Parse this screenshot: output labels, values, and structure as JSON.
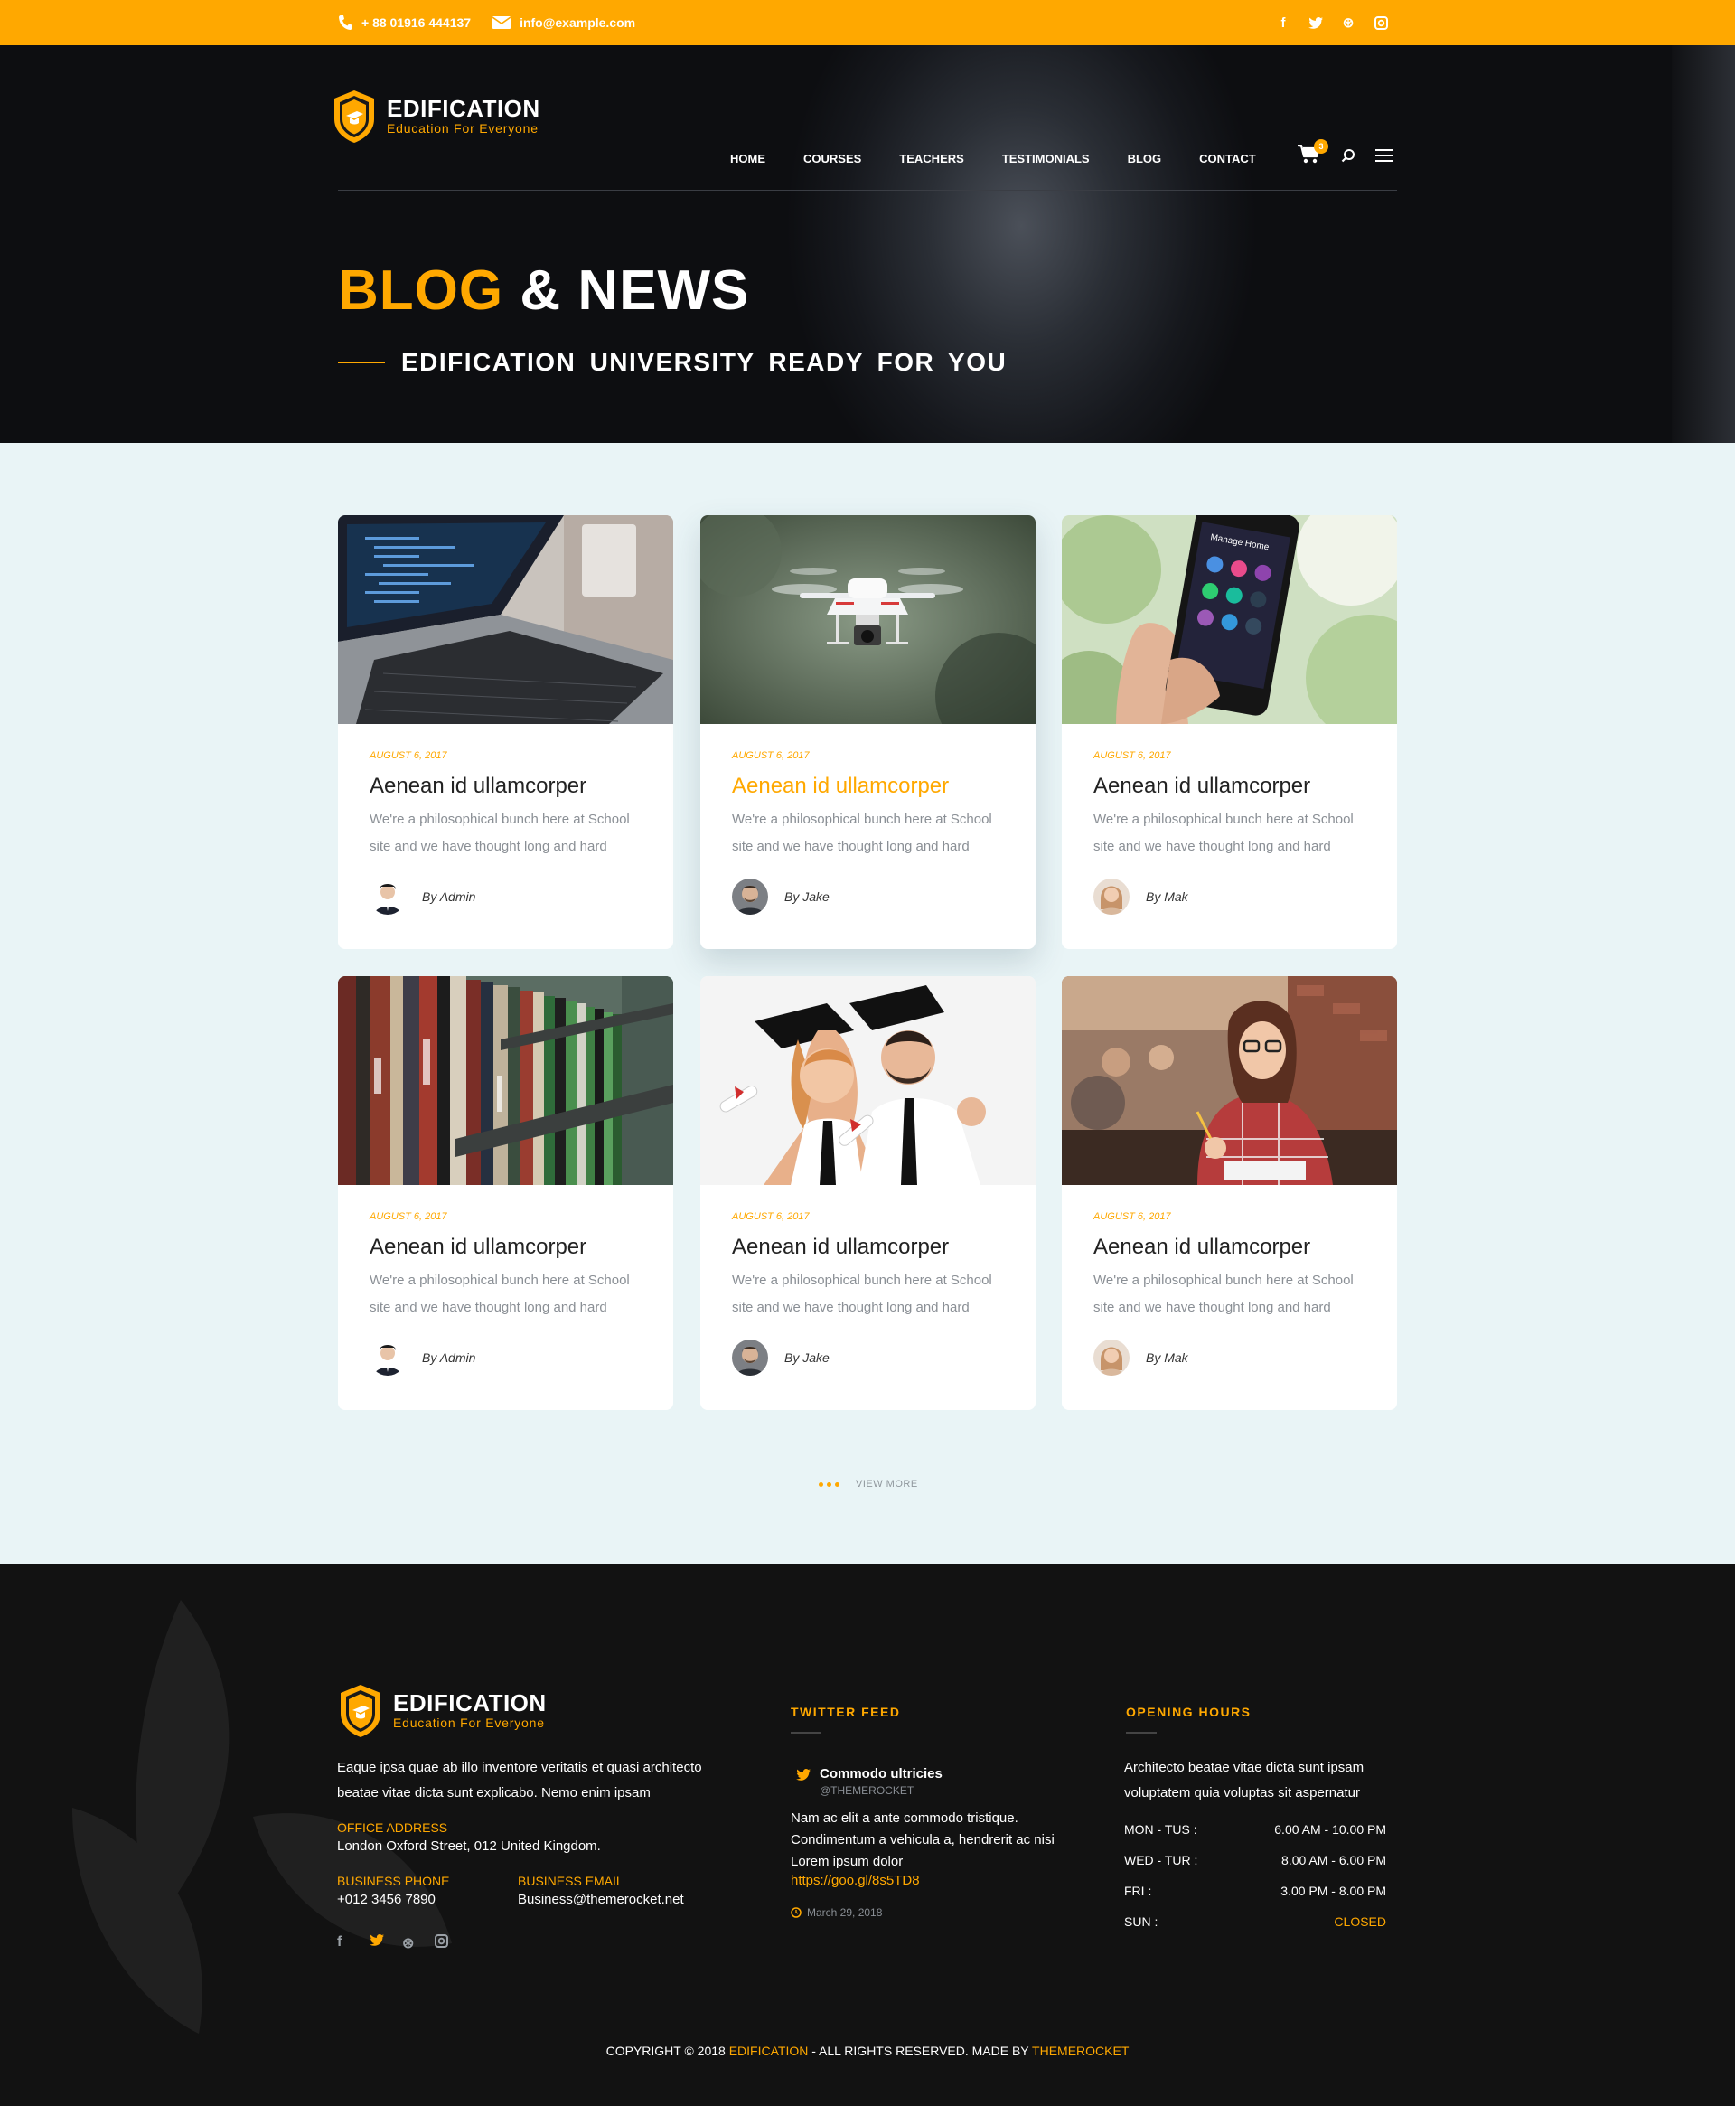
{
  "topbar": {
    "phone": "+ 88 01916 444137",
    "email": "info@example.com",
    "social": [
      {
        "icon": "facebook-icon",
        "glyph": "f"
      },
      {
        "icon": "twitter-icon",
        "glyph": "t"
      },
      {
        "icon": "dribbble-icon",
        "glyph": "⊛"
      },
      {
        "icon": "instagram-icon",
        "glyph": "◙"
      }
    ]
  },
  "brand": {
    "name": "EDIFICATION",
    "tagline": "Education For Everyone"
  },
  "nav": {
    "items": [
      "HOME",
      "COURSES",
      "TEACHERS",
      "TESTIMONIALS",
      "BLOG",
      "CONTACT"
    ],
    "cart_count": "3"
  },
  "hero": {
    "title_accent": "BLOG",
    "title_rest": "& NEWS",
    "subtitle": "EDIFICATION UNIVERSITY READY FOR YOU"
  },
  "posts": [
    {
      "date": "AUGUST 6, 2017",
      "title": "Aenean id ullamcorper",
      "excerpt": "We're a philosophical bunch here at School site and we have thought long and hard",
      "author": "By Admin",
      "image": "laptop-code"
    },
    {
      "date": "AUGUST 6, 2017",
      "title": "Aenean id ullamcorper",
      "excerpt": "We're a philosophical bunch here at School site and we have thought long and hard",
      "author": "By Jake",
      "image": "drone"
    },
    {
      "date": "AUGUST 6, 2017",
      "title": "Aenean id ullamcorper",
      "excerpt": "We're a philosophical bunch here at School site and we have thought long and hard",
      "author": "By Mak",
      "image": "smartphone"
    },
    {
      "date": "AUGUST 6, 2017",
      "title": "Aenean id ullamcorper",
      "excerpt": "We're a philosophical bunch here at School site and we have thought long and hard",
      "author": "By Admin",
      "image": "bookshelf"
    },
    {
      "date": "AUGUST 6, 2017",
      "title": "Aenean id ullamcorper",
      "excerpt": "We're a philosophical bunch here at School site and we have thought long and hard",
      "author": "By Jake",
      "image": "graduates"
    },
    {
      "date": "AUGUST 6, 2017",
      "title": "Aenean id ullamcorper",
      "excerpt": "We're a philosophical bunch here at School site and we have thought long and hard",
      "author": "By Mak",
      "image": "student-studying"
    }
  ],
  "view_more": "VIEW MORE",
  "footer": {
    "about": "Eaque ipsa quae ab illo inventore veritatis et quasi architecto beatae vitae dicta sunt explicabo. Nemo enim ipsam",
    "office_label": "OFFICE ADDRESS",
    "office_value": "London Oxford Street, 012 United Kingdom.",
    "phone_label": "BUSINESS PHONE",
    "phone_value": "+012 3456 7890",
    "email_label": "BUSINESS EMAIL",
    "email_value": "Business@themerocket.net",
    "twitter": {
      "heading": "TWITTER FEED",
      "name": "Commodo ultricies",
      "handle": "@THEMEROCKET",
      "text": "Nam ac elit a ante commodo tristique. Condimentum a vehicula a, hendrerit ac nisi Lorem ipsum dolor",
      "link": "https://goo.gl/8s5TD8",
      "date": "March 29, 2018"
    },
    "hours": {
      "heading": "OPENING HOURS",
      "text": "Architecto beatae vitae dicta sunt ipsam voluptatem quia voluptas sit aspernatur",
      "rows": [
        {
          "day": "MON - TUS :",
          "time": "6.00 AM - 10.00 PM"
        },
        {
          "day": "WED - TUR :",
          "time": "8.00 AM - 6.00 PM"
        },
        {
          "day": "FRI :",
          "time": "3.00 PM - 8.00 PM"
        },
        {
          "day": "SUN :",
          "time": "CLOSED"
        }
      ]
    },
    "copyright_pre": "COPYRIGHT © 2018",
    "copyright_brand": "EDIFICATION",
    "copyright_mid": "-  ALL RIGHTS RESERVED. MADE BY",
    "copyright_maker": "THEMEROCKET"
  },
  "colors": {
    "accent": "#ffa800",
    "dark": "#121212",
    "page_bg": "#e9f4f6"
  }
}
